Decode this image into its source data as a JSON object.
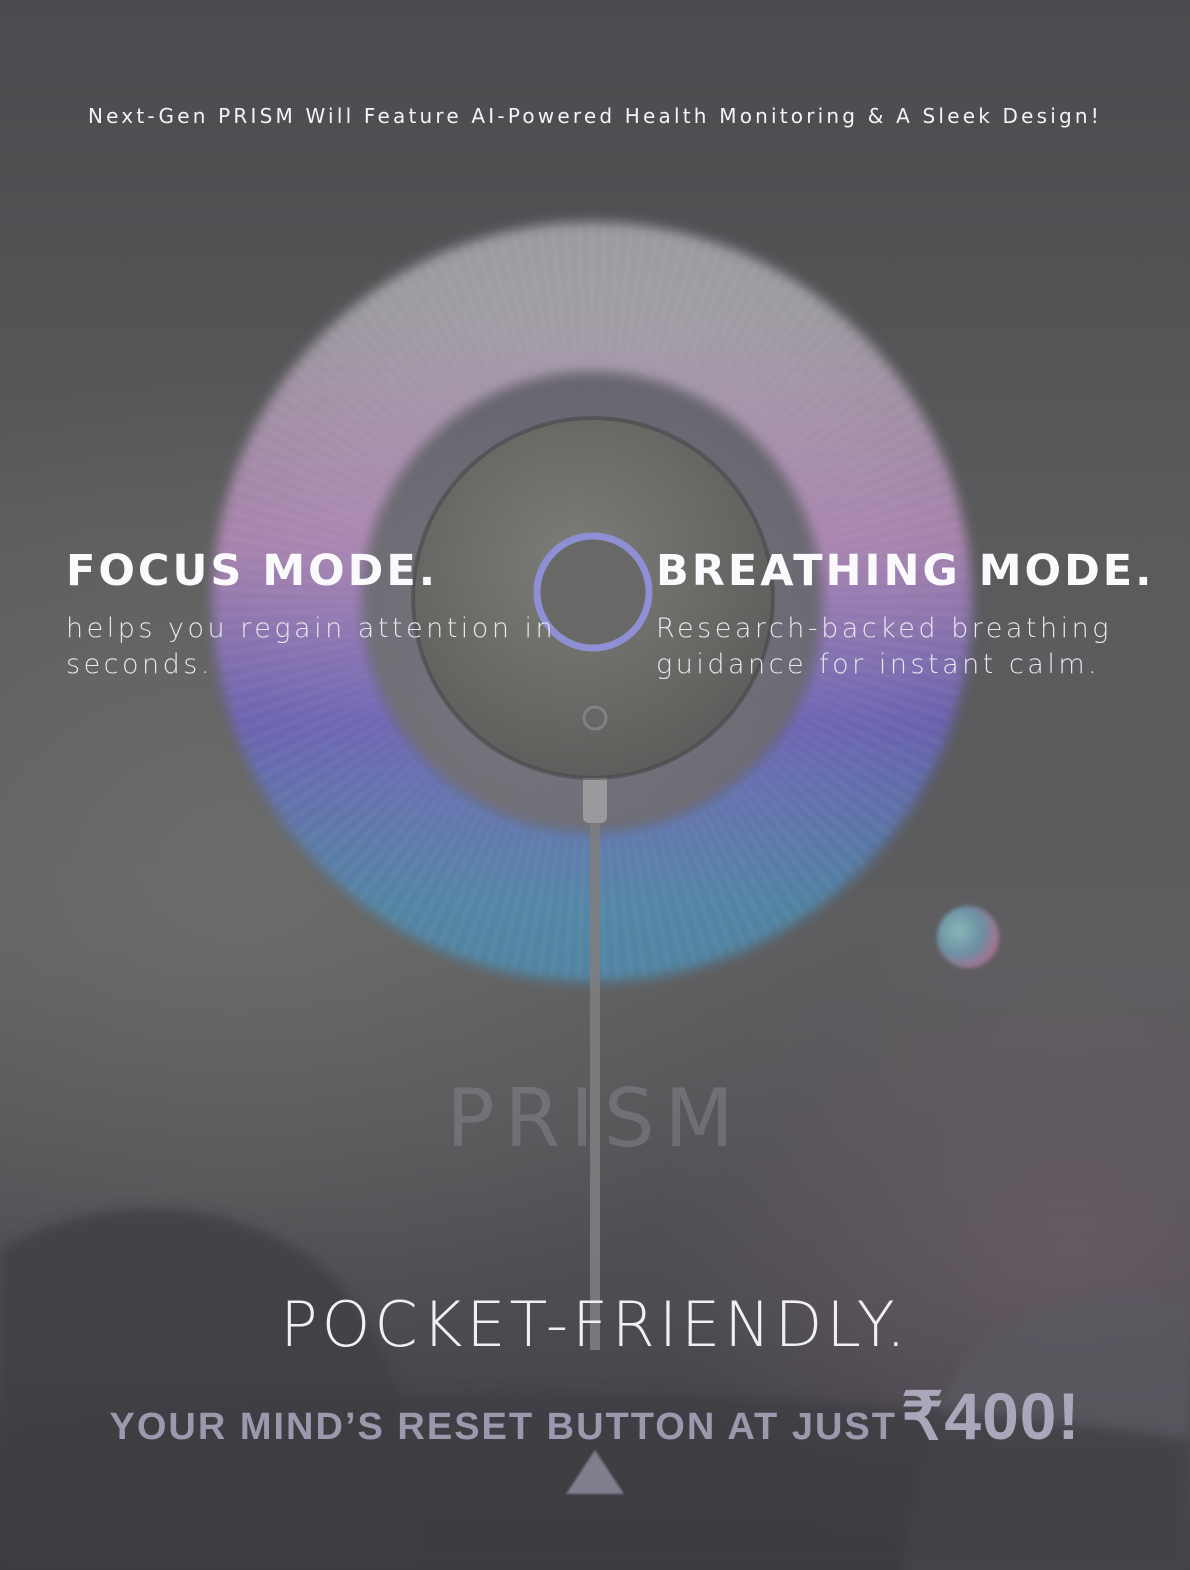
{
  "headline": "Next-Gen PRISM Will Feature AI-Powered Health Monitoring & A Sleek Design!",
  "focus_mode": {
    "title": "FOCUS MODE.",
    "description": "helps you regain attention in seconds."
  },
  "breathing_mode": {
    "title": "BREATHING MODE.",
    "description": "Research-backed breathing guidance for instant calm."
  },
  "brand_watermark": "PRISM",
  "pocket_friendly": "POCKET-FRIENDLY.",
  "tagline": {
    "lead": "YOUR MIND’S RESET BUTTON AT JUST",
    "price": "₹400!"
  },
  "colors": {
    "background": "#5a5b5c",
    "text": "#f2f2f4",
    "tagline": "#9a99ad"
  },
  "icons": {
    "scroll_arrow": "up-triangle-icon"
  }
}
